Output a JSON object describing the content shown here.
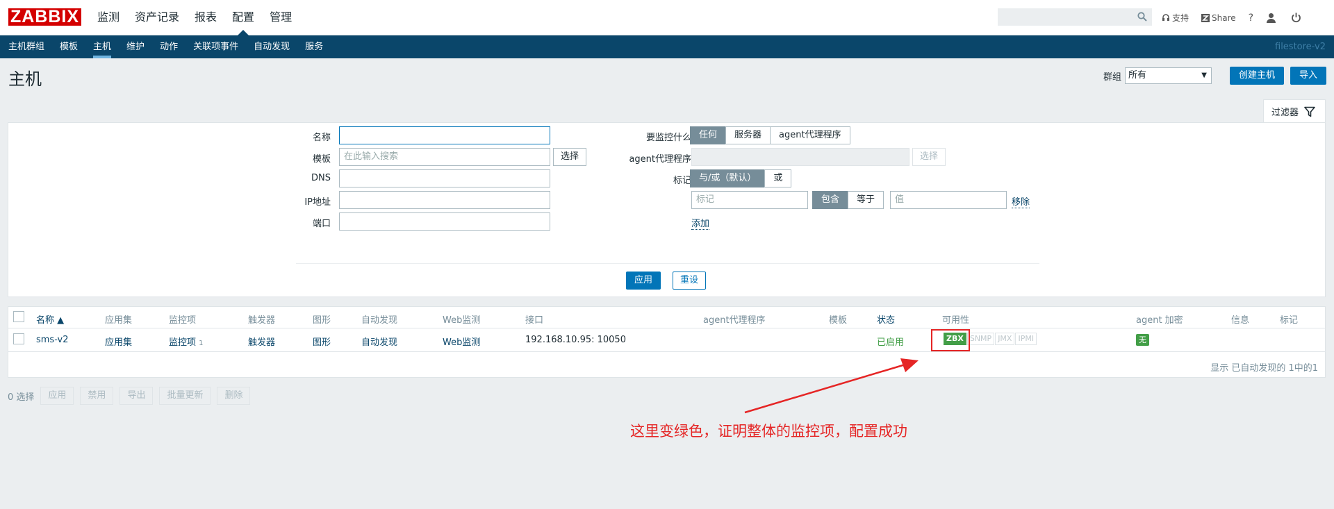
{
  "logo": "ZABBIX",
  "main_menu": [
    "监测",
    "资产记录",
    "报表",
    "配置",
    "管理"
  ],
  "top_right": {
    "support": "支持",
    "share": "Share",
    "help": "?"
  },
  "sub_menu": [
    "主机群组",
    "模板",
    "主机",
    "维护",
    "动作",
    "关联项事件",
    "自动发现",
    "服务"
  ],
  "server_name": "filestore-v2",
  "page_title": "主机",
  "group": {
    "label": "群组",
    "value": "所有"
  },
  "header_buttons": {
    "create": "创建主机",
    "import": "导入"
  },
  "filter_tab": "过滤器",
  "filter": {
    "name_label": "名称",
    "template_label": "模板",
    "template_placeholder": "在此输入搜索",
    "select_label": "选择",
    "dns_label": "DNS",
    "ip_label": "IP地址",
    "port_label": "端口",
    "monitor_label": "要监控什么",
    "monitor_options": [
      "任何",
      "服务器",
      "agent代理程序"
    ],
    "proxy_label": "agent代理程序",
    "proxy_select": "选择",
    "tags_label": "标记",
    "tags_mode": [
      "与/或（默认）",
      "或"
    ],
    "tag_placeholder": "标记",
    "tag_ops": [
      "包含",
      "等于"
    ],
    "value_placeholder": "值",
    "remove": "移除",
    "add": "添加",
    "apply": "应用",
    "reset": "重设"
  },
  "table": {
    "headers": [
      "名称 ▲",
      "应用集",
      "监控项",
      "触发器",
      "图形",
      "自动发现",
      "Web监测",
      "接口",
      "agent代理程序",
      "模板",
      "状态",
      "可用性",
      "agent 加密",
      "信息",
      "标记"
    ],
    "row": {
      "name": "sms-v2",
      "apps": "应用集",
      "items": "监控项",
      "items_count": "1",
      "triggers": "触发器",
      "graphs": "图形",
      "discovery": "自动发现",
      "web": "Web监测",
      "interface": "192.168.10.95: 10050",
      "status": "已启用",
      "availability": [
        "ZBX",
        "SNMP",
        "JMX",
        "IPMI"
      ],
      "encryption": "无"
    },
    "paging": "显示 已自动发现的 1中的1"
  },
  "bottom": {
    "selected": "0 选择",
    "buttons": [
      "应用",
      "禁用",
      "导出",
      "批量更新",
      "删除"
    ]
  },
  "annotation": "这里变绿色，证明整体的监控项，配置成功",
  "colors": {
    "brand": "#d40000",
    "nav": "#0a466a",
    "accent": "#0275b8",
    "ok": "#429e47",
    "annotation": "#e52525"
  }
}
